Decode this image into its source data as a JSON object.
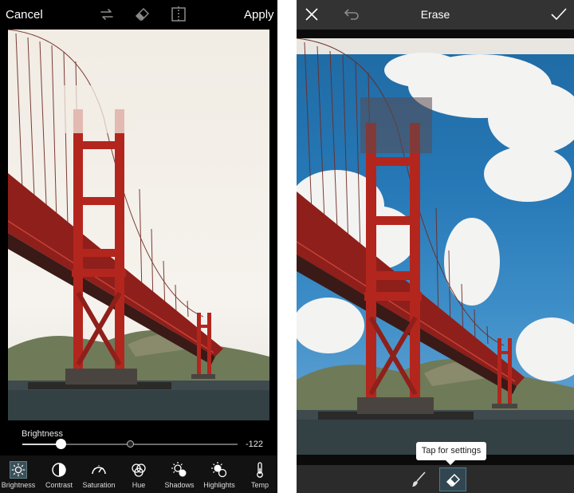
{
  "left": {
    "header": {
      "cancel_label": "Cancel",
      "apply_label": "Apply",
      "icons": [
        "swap-icon",
        "eraser-icon",
        "compare-icon"
      ]
    },
    "adjust": {
      "label": "Brightness",
      "value_text": "-122",
      "level_fraction": 0.18,
      "default_fraction": 0.5
    },
    "tools": [
      {
        "id": "brightness",
        "label": "Brightness",
        "icon": "sun-icon",
        "active": true
      },
      {
        "id": "contrast",
        "label": "Contrast",
        "icon": "half-circle-icon",
        "active": false
      },
      {
        "id": "saturation",
        "label": "Saturation",
        "icon": "gauge-icon",
        "active": false
      },
      {
        "id": "hue",
        "label": "Hue",
        "icon": "color-circles-icon",
        "active": false
      },
      {
        "id": "shadows",
        "label": "Shadows",
        "icon": "shadow-sun-icon",
        "active": false
      },
      {
        "id": "highlights",
        "label": "Highlights",
        "icon": "highlight-sun-icon",
        "active": false
      },
      {
        "id": "temp",
        "label": "Temp",
        "icon": "thermometer-icon",
        "active": false
      }
    ]
  },
  "right": {
    "header": {
      "title": "Erase",
      "icons": [
        "close-icon",
        "undo-icon",
        "checkmark-icon"
      ]
    },
    "tooltip": "Tap for settings",
    "tools": [
      {
        "id": "brush",
        "icon": "brush-icon",
        "active": false
      },
      {
        "id": "eraser",
        "icon": "eraser-icon",
        "active": true
      }
    ]
  },
  "colors": {
    "bridge_red": "#b3261e",
    "sky_blue": "#2678b6",
    "active_tool": "#3b4f58",
    "header_dark": "#333333"
  }
}
